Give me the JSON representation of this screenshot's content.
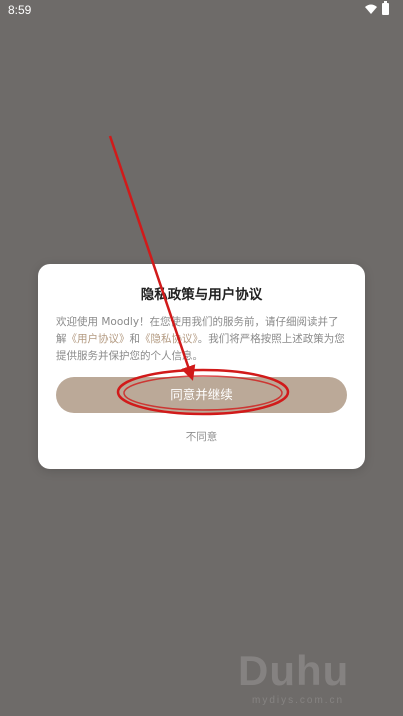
{
  "status_bar": {
    "time": "8:59",
    "icons": [
      "wifi-icon",
      "battery-icon"
    ]
  },
  "dialog": {
    "title": "隐私政策与用户协议",
    "body": {
      "intro": "欢迎使用 Moodly！在您使用我们的服务前，请仔细阅读并了解",
      "user_agreement_link": "《用户协议》",
      "conjunction": "和",
      "privacy_policy_link": "《隐私协议》",
      "outro": "。我们将严格按照上述政策为您提供服务并保护您的个人信息。"
    },
    "agree_button_label": "同意并继续",
    "disagree_label": "不同意"
  },
  "watermark": {
    "main": "Duhu",
    "sub": "mydiys.com.cn"
  },
  "colors": {
    "overlay_background": "#6e6b69",
    "accent_button": "#bba998",
    "link": "#b39a81",
    "annotation": "#d11a1a"
  }
}
